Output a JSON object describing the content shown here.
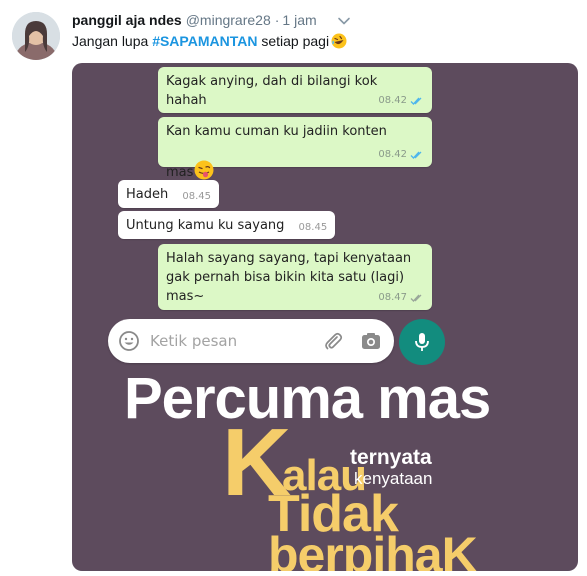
{
  "tweet": {
    "display_name": "panggil aja ndes",
    "handle": "@mingrare28",
    "separator": "·",
    "time": "1 jam",
    "text_before": "Jangan lupa ",
    "hashtag": "#SAPAMANTAN",
    "text_after": " setiap pagi",
    "trailing_emoji": "rolling-on-floor-laughing-emoji"
  },
  "chat": {
    "messages": [
      {
        "direction": "out",
        "text": "Kagak anying, dah di bilangi kok\nhahah",
        "time": "08.42",
        "status": "read"
      },
      {
        "direction": "out",
        "text": "Kan kamu cuman ku jadiin konten\nmas",
        "time": "08.42",
        "status": "read",
        "emoji": "winking-face-with-tongue-emoji"
      },
      {
        "direction": "in",
        "text": "Hadeh",
        "time": "08.45"
      },
      {
        "direction": "in",
        "text": "Untung kamu ku sayang",
        "time": "08.45"
      },
      {
        "direction": "out",
        "text": "Halah sayang sayang, tapi kenyataan\ngak pernah bisa bikin kita satu (lagi)\nmas~",
        "time": "08.47",
        "status": "delivered"
      }
    ],
    "input_placeholder": "Ketik pesan"
  },
  "overlay": {
    "headline": "Percuma mas",
    "big_letter": "K",
    "line_kalau": "alau",
    "line_ternyata": "ternyata",
    "line_kenyataan": "kenyataan",
    "line_tidak": "Tidak",
    "line_berpihak": "berpihaK"
  },
  "colors": {
    "background": "#5d4b5d",
    "bubble_out": "#dcf8c6",
    "bubble_in": "#ffffff",
    "accent_yellow": "#f5cd6a",
    "mic_green": "#128c7e",
    "hashtag_blue": "#1b95e0",
    "read_ticks": "#4fb6ec"
  }
}
